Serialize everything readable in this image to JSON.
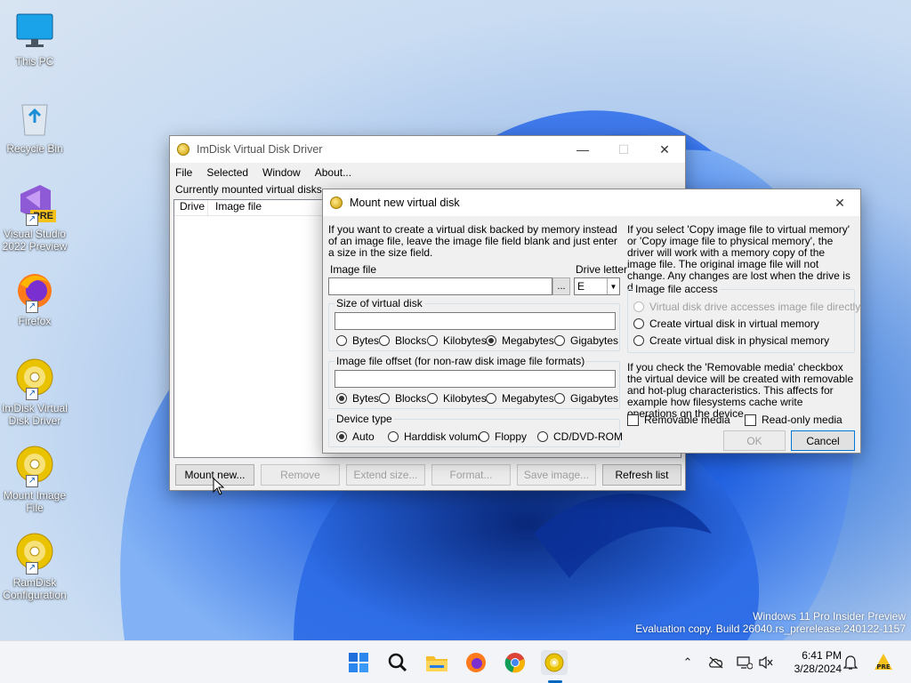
{
  "desktop": {
    "icons": [
      {
        "label": "This PC"
      },
      {
        "label": "Recycle Bin"
      },
      {
        "label": "Visual Studio 2022 Preview",
        "badge": "PRE"
      },
      {
        "label": "Firefox"
      },
      {
        "label": "ImDisk Virtual Disk Driver"
      },
      {
        "label": "Mount Image File"
      },
      {
        "label": "RamDisk Configuration"
      }
    ],
    "watermark_line1": "Windows 11 Pro Insider Preview",
    "watermark_line2": "Evaluation copy. Build 26040.rs_prerelease.240122-1157"
  },
  "main_window": {
    "title": "ImDisk Virtual Disk Driver",
    "menu": [
      "File",
      "Selected",
      "Window",
      "About..."
    ],
    "list_caption": "Currently mounted virtual disks",
    "columns": [
      "Drive",
      "Image file"
    ],
    "buttons": {
      "mount": "Mount new...",
      "remove": "Remove",
      "extend": "Extend size...",
      "format": "Format...",
      "save": "Save image...",
      "refresh": "Refresh list"
    }
  },
  "dialog": {
    "title": "Mount new virtual disk",
    "intro": "If you want to create a virtual disk backed by memory instead of an image file, leave the image file field blank and just enter a size in the size field.",
    "image_file_label": "Image file",
    "browse_label": "...",
    "drive_letter_label": "Drive letter",
    "drive_letter_value": "E",
    "size_group": {
      "title": "Size of virtual disk",
      "value": "",
      "units": [
        "Bytes",
        "Blocks",
        "Kilobytes",
        "Megabytes",
        "Gigabytes"
      ],
      "selected": "Megabytes"
    },
    "offset_group": {
      "title": "Image file offset (for non-raw disk image file formats)",
      "value": "",
      "units": [
        "Bytes",
        "Blocks",
        "Kilobytes",
        "Megabytes",
        "Gigabytes"
      ],
      "selected": "Bytes"
    },
    "device_type": {
      "title": "Device type",
      "options": [
        "Auto",
        "Harddisk volume",
        "Floppy",
        "CD/DVD-ROM"
      ],
      "selected": "Auto"
    },
    "copy_info": "If you select 'Copy image file to virtual memory' or 'Copy image file to physical memory', the driver will work with a memory copy of the image file. The original image file will not change. Any changes are lost when the drive is dismounted.",
    "access_group": {
      "title": "Image file access",
      "options": [
        "Virtual disk drive accesses image file directly",
        "Create virtual disk in virtual memory",
        "Create virtual disk in physical memory"
      ]
    },
    "removable_info": "If you check the 'Removable media' checkbox the virtual device will be created with removable and hot-plug characteristics. This affects for example how filesystems cache write operations on the device.",
    "removable_label": "Removable media",
    "readonly_label": "Read-only media",
    "ok_label": "OK",
    "cancel_label": "Cancel"
  },
  "taskbar": {
    "time": "6:41 PM",
    "date": "3/28/2024",
    "apps": [
      "start-icon",
      "search-icon",
      "file-explorer-icon",
      "firefox-icon",
      "chrome-icon",
      "imdisk-icon"
    ]
  }
}
